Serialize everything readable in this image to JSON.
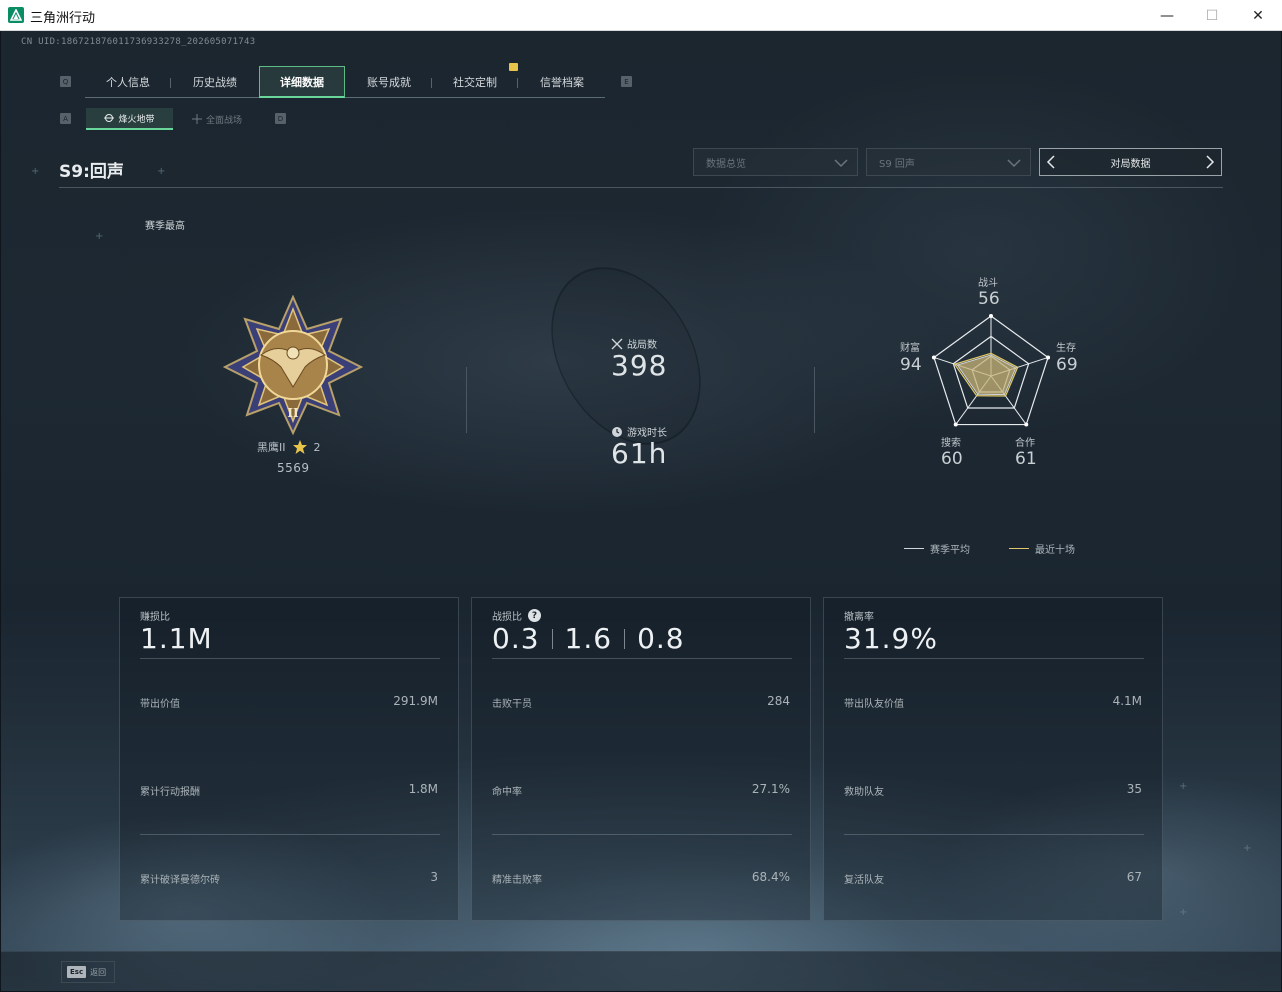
{
  "window": {
    "title": "三角洲行动",
    "minimize": "—",
    "maximize": "☐",
    "close": "✕"
  },
  "uid": "CN UID:186721876011736933278_202605071743",
  "tabs": [
    {
      "label": "个人信息",
      "active": false
    },
    {
      "label": "历史战绩",
      "active": false
    },
    {
      "label": "详细数据",
      "active": true
    },
    {
      "label": "账号成就",
      "active": false
    },
    {
      "label": "社交定制",
      "active": false
    },
    {
      "label": "信誉档案",
      "active": false
    }
  ],
  "key_hints": {
    "prev_tab": "Q",
    "next_tab": "E",
    "prev_sub": "A",
    "next_sub": "D"
  },
  "subtabs": [
    {
      "label": "烽火地带",
      "icon": "target-icon",
      "active": true
    },
    {
      "label": "全面战场",
      "icon": "crosshair-icon",
      "active": false
    }
  ],
  "season": {
    "title": "S9:回声",
    "dropdown_category": "数据总览",
    "dropdown_season": "S9 回声",
    "match_nav_label": "对局数据",
    "best_label": "赛季最高"
  },
  "rank": {
    "name": "黑鹰II",
    "stars": "2",
    "score": "5569",
    "star_color": "#e8c54a"
  },
  "summary": {
    "matches_label": "战局数",
    "matches_value": "398",
    "playtime_label": "游戏时长",
    "playtime_value": "61h"
  },
  "radar": {
    "axes": [
      {
        "label": "战斗",
        "value": "56",
        "score": 56
      },
      {
        "label": "生存",
        "value": "69",
        "score": 69
      },
      {
        "label": "合作",
        "value": "61",
        "score": 61
      },
      {
        "label": "搜索",
        "value": "60",
        "score": 60
      },
      {
        "label": "财富",
        "value": "94",
        "score": 94
      }
    ],
    "legend": [
      {
        "label": "赛季平均",
        "color": "#cfd5d8"
      },
      {
        "label": "最近十场",
        "color": "#e0c66a"
      }
    ]
  },
  "cards": [
    {
      "label": "赚损比",
      "big": [
        "1.1M"
      ],
      "rows": [
        {
          "name": "带出价值",
          "value": "291.9M"
        },
        {
          "name": "累计行动报酬",
          "value": "1.8M"
        },
        {
          "name": "累计破译曼德尔砖",
          "value": "3"
        }
      ]
    },
    {
      "label": "战损比",
      "help": "?",
      "big": [
        "0.3",
        "1.6",
        "0.8"
      ],
      "rows": [
        {
          "name": "击败干员",
          "value": "284"
        },
        {
          "name": "命中率",
          "value": "27.1%"
        },
        {
          "name": "精准击败率",
          "value": "68.4%"
        }
      ]
    },
    {
      "label": "撤离率",
      "big": [
        "31.9%"
      ],
      "rows": [
        {
          "name": "带出队友价值",
          "value": "4.1M"
        },
        {
          "name": "救助队友",
          "value": "35"
        },
        {
          "name": "复活队友",
          "value": "67"
        }
      ]
    }
  ],
  "footer": {
    "esc_key": "Esc",
    "esc_label": "返回"
  },
  "colors": {
    "accent": "#6ad79a",
    "gold": "#e8c54a"
  }
}
